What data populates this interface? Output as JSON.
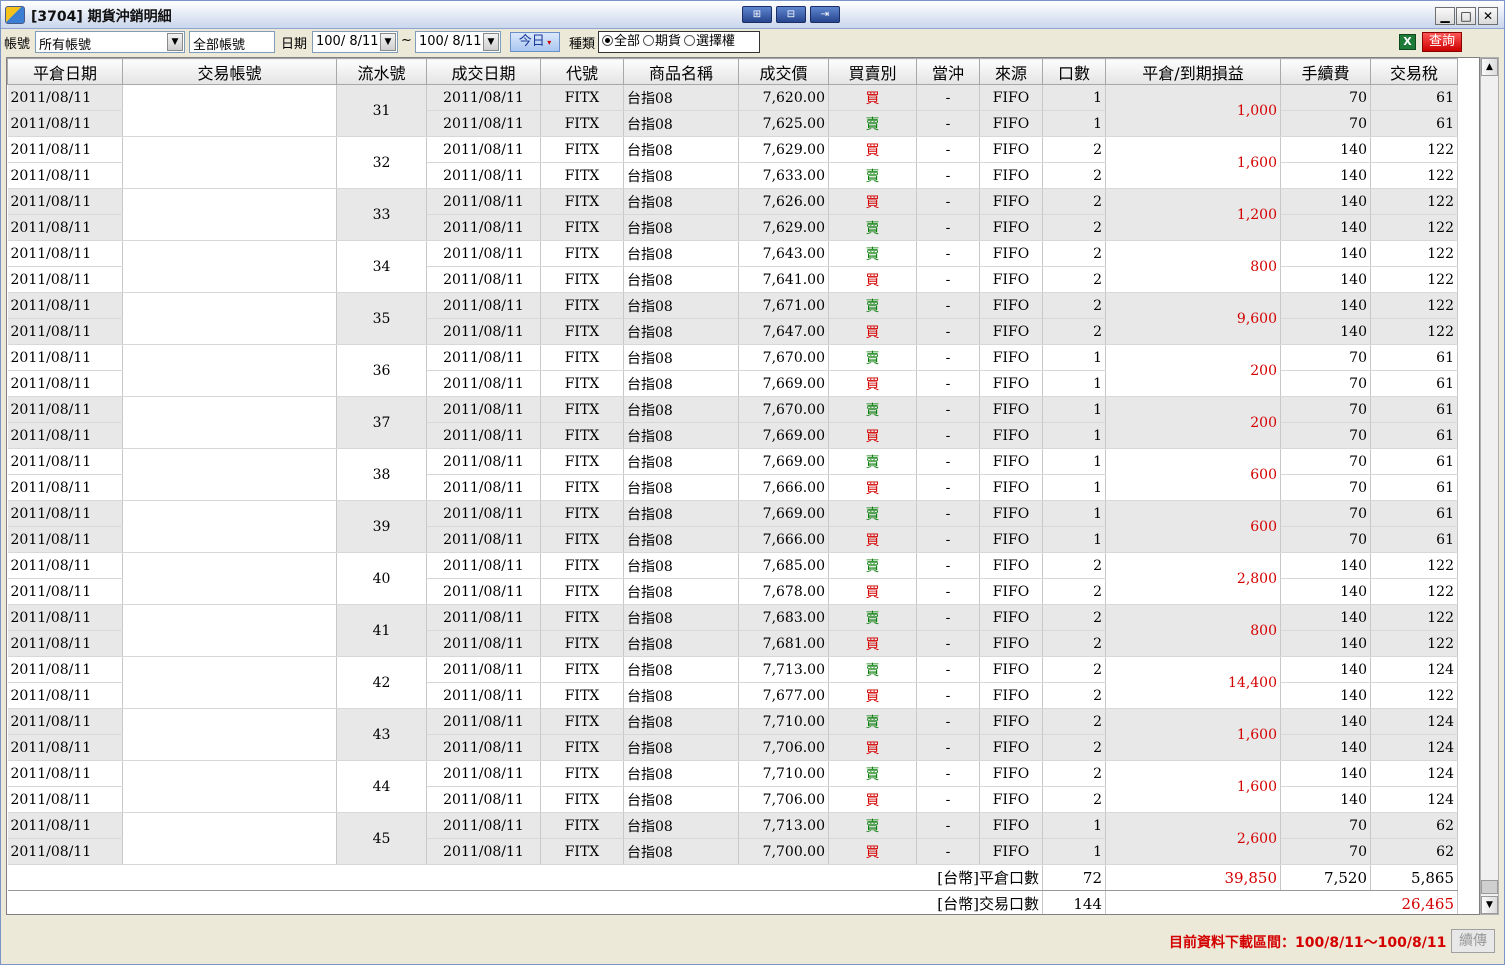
{
  "window": {
    "title": "[3704] 期貨沖銷明細",
    "mid_buttons": [
      "⊞",
      "⊟",
      "⇥"
    ],
    "controls": {
      "minimize": "▁",
      "maximize": "□",
      "close": "✕"
    }
  },
  "toolbar": {
    "account_label": "帳號",
    "account_value": "所有帳號",
    "account_type_value": "全部帳號",
    "date_label": "日期",
    "date_from": "100/ 8/11",
    "date_sep": "~",
    "date_to": "100/ 8/11",
    "today_label": "今日",
    "type_label": "種類",
    "type_options": [
      "全部",
      "期貨",
      "選擇權"
    ],
    "type_selected": "全部",
    "excel_icon": "X",
    "query_label": "查詢"
  },
  "grid": {
    "headers": [
      "平倉日期",
      "交易帳號",
      "流水號",
      "成交日期",
      "代號",
      "商品名稱",
      "成交價",
      "買賣別",
      "當沖",
      "來源",
      "口數",
      "平倉/到期損益",
      "手續費",
      "交易稅"
    ],
    "groups": [
      {
        "seq": "31",
        "pnl": "1,000",
        "rows": [
          {
            "close_date": "2011/08/11",
            "trade_date": "2011/08/11",
            "code": "FITX",
            "name": "台指08",
            "price": "7,620.00",
            "side": "買",
            "daytrade": "-",
            "source": "FIFO",
            "qty": "1",
            "fee": "70",
            "tax": "61"
          },
          {
            "close_date": "2011/08/11",
            "trade_date": "2011/08/11",
            "code": "FITX",
            "name": "台指08",
            "price": "7,625.00",
            "side": "賣",
            "daytrade": "-",
            "source": "FIFO",
            "qty": "1",
            "fee": "70",
            "tax": "61"
          }
        ]
      },
      {
        "seq": "32",
        "pnl": "1,600",
        "rows": [
          {
            "close_date": "2011/08/11",
            "trade_date": "2011/08/11",
            "code": "FITX",
            "name": "台指08",
            "price": "7,629.00",
            "side": "買",
            "daytrade": "-",
            "source": "FIFO",
            "qty": "2",
            "fee": "140",
            "tax": "122"
          },
          {
            "close_date": "2011/08/11",
            "trade_date": "2011/08/11",
            "code": "FITX",
            "name": "台指08",
            "price": "7,633.00",
            "side": "賣",
            "daytrade": "-",
            "source": "FIFO",
            "qty": "2",
            "fee": "140",
            "tax": "122"
          }
        ]
      },
      {
        "seq": "33",
        "pnl": "1,200",
        "rows": [
          {
            "close_date": "2011/08/11",
            "trade_date": "2011/08/11",
            "code": "FITX",
            "name": "台指08",
            "price": "7,626.00",
            "side": "買",
            "daytrade": "-",
            "source": "FIFO",
            "qty": "2",
            "fee": "140",
            "tax": "122"
          },
          {
            "close_date": "2011/08/11",
            "trade_date": "2011/08/11",
            "code": "FITX",
            "name": "台指08",
            "price": "7,629.00",
            "side": "賣",
            "daytrade": "-",
            "source": "FIFO",
            "qty": "2",
            "fee": "140",
            "tax": "122"
          }
        ]
      },
      {
        "seq": "34",
        "pnl": "800",
        "rows": [
          {
            "close_date": "2011/08/11",
            "trade_date": "2011/08/11",
            "code": "FITX",
            "name": "台指08",
            "price": "7,643.00",
            "side": "賣",
            "daytrade": "-",
            "source": "FIFO",
            "qty": "2",
            "fee": "140",
            "tax": "122"
          },
          {
            "close_date": "2011/08/11",
            "trade_date": "2011/08/11",
            "code": "FITX",
            "name": "台指08",
            "price": "7,641.00",
            "side": "買",
            "daytrade": "-",
            "source": "FIFO",
            "qty": "2",
            "fee": "140",
            "tax": "122"
          }
        ]
      },
      {
        "seq": "35",
        "pnl": "9,600",
        "rows": [
          {
            "close_date": "2011/08/11",
            "trade_date": "2011/08/11",
            "code": "FITX",
            "name": "台指08",
            "price": "7,671.00",
            "side": "賣",
            "daytrade": "-",
            "source": "FIFO",
            "qty": "2",
            "fee": "140",
            "tax": "122"
          },
          {
            "close_date": "2011/08/11",
            "trade_date": "2011/08/11",
            "code": "FITX",
            "name": "台指08",
            "price": "7,647.00",
            "side": "買",
            "daytrade": "-",
            "source": "FIFO",
            "qty": "2",
            "fee": "140",
            "tax": "122"
          }
        ]
      },
      {
        "seq": "36",
        "pnl": "200",
        "rows": [
          {
            "close_date": "2011/08/11",
            "trade_date": "2011/08/11",
            "code": "FITX",
            "name": "台指08",
            "price": "7,670.00",
            "side": "賣",
            "daytrade": "-",
            "source": "FIFO",
            "qty": "1",
            "fee": "70",
            "tax": "61"
          },
          {
            "close_date": "2011/08/11",
            "trade_date": "2011/08/11",
            "code": "FITX",
            "name": "台指08",
            "price": "7,669.00",
            "side": "買",
            "daytrade": "-",
            "source": "FIFO",
            "qty": "1",
            "fee": "70",
            "tax": "61"
          }
        ]
      },
      {
        "seq": "37",
        "pnl": "200",
        "rows": [
          {
            "close_date": "2011/08/11",
            "trade_date": "2011/08/11",
            "code": "FITX",
            "name": "台指08",
            "price": "7,670.00",
            "side": "賣",
            "daytrade": "-",
            "source": "FIFO",
            "qty": "1",
            "fee": "70",
            "tax": "61"
          },
          {
            "close_date": "2011/08/11",
            "trade_date": "2011/08/11",
            "code": "FITX",
            "name": "台指08",
            "price": "7,669.00",
            "side": "買",
            "daytrade": "-",
            "source": "FIFO",
            "qty": "1",
            "fee": "70",
            "tax": "61"
          }
        ]
      },
      {
        "seq": "38",
        "pnl": "600",
        "rows": [
          {
            "close_date": "2011/08/11",
            "trade_date": "2011/08/11",
            "code": "FITX",
            "name": "台指08",
            "price": "7,669.00",
            "side": "賣",
            "daytrade": "-",
            "source": "FIFO",
            "qty": "1",
            "fee": "70",
            "tax": "61"
          },
          {
            "close_date": "2011/08/11",
            "trade_date": "2011/08/11",
            "code": "FITX",
            "name": "台指08",
            "price": "7,666.00",
            "side": "買",
            "daytrade": "-",
            "source": "FIFO",
            "qty": "1",
            "fee": "70",
            "tax": "61"
          }
        ]
      },
      {
        "seq": "39",
        "pnl": "600",
        "rows": [
          {
            "close_date": "2011/08/11",
            "trade_date": "2011/08/11",
            "code": "FITX",
            "name": "台指08",
            "price": "7,669.00",
            "side": "賣",
            "daytrade": "-",
            "source": "FIFO",
            "qty": "1",
            "fee": "70",
            "tax": "61"
          },
          {
            "close_date": "2011/08/11",
            "trade_date": "2011/08/11",
            "code": "FITX",
            "name": "台指08",
            "price": "7,666.00",
            "side": "買",
            "daytrade": "-",
            "source": "FIFO",
            "qty": "1",
            "fee": "70",
            "tax": "61"
          }
        ]
      },
      {
        "seq": "40",
        "pnl": "2,800",
        "rows": [
          {
            "close_date": "2011/08/11",
            "trade_date": "2011/08/11",
            "code": "FITX",
            "name": "台指08",
            "price": "7,685.00",
            "side": "賣",
            "daytrade": "-",
            "source": "FIFO",
            "qty": "2",
            "fee": "140",
            "tax": "122"
          },
          {
            "close_date": "2011/08/11",
            "trade_date": "2011/08/11",
            "code": "FITX",
            "name": "台指08",
            "price": "7,678.00",
            "side": "買",
            "daytrade": "-",
            "source": "FIFO",
            "qty": "2",
            "fee": "140",
            "tax": "122"
          }
        ]
      },
      {
        "seq": "41",
        "pnl": "800",
        "rows": [
          {
            "close_date": "2011/08/11",
            "trade_date": "2011/08/11",
            "code": "FITX",
            "name": "台指08",
            "price": "7,683.00",
            "side": "賣",
            "daytrade": "-",
            "source": "FIFO",
            "qty": "2",
            "fee": "140",
            "tax": "122"
          },
          {
            "close_date": "2011/08/11",
            "trade_date": "2011/08/11",
            "code": "FITX",
            "name": "台指08",
            "price": "7,681.00",
            "side": "買",
            "daytrade": "-",
            "source": "FIFO",
            "qty": "2",
            "fee": "140",
            "tax": "122"
          }
        ]
      },
      {
        "seq": "42",
        "pnl": "14,400",
        "rows": [
          {
            "close_date": "2011/08/11",
            "trade_date": "2011/08/11",
            "code": "FITX",
            "name": "台指08",
            "price": "7,713.00",
            "side": "賣",
            "daytrade": "-",
            "source": "FIFO",
            "qty": "2",
            "fee": "140",
            "tax": "124"
          },
          {
            "close_date": "2011/08/11",
            "trade_date": "2011/08/11",
            "code": "FITX",
            "name": "台指08",
            "price": "7,677.00",
            "side": "買",
            "daytrade": "-",
            "source": "FIFO",
            "qty": "2",
            "fee": "140",
            "tax": "122"
          }
        ]
      },
      {
        "seq": "43",
        "pnl": "1,600",
        "rows": [
          {
            "close_date": "2011/08/11",
            "trade_date": "2011/08/11",
            "code": "FITX",
            "name": "台指08",
            "price": "7,710.00",
            "side": "賣",
            "daytrade": "-",
            "source": "FIFO",
            "qty": "2",
            "fee": "140",
            "tax": "124"
          },
          {
            "close_date": "2011/08/11",
            "trade_date": "2011/08/11",
            "code": "FITX",
            "name": "台指08",
            "price": "7,706.00",
            "side": "買",
            "daytrade": "-",
            "source": "FIFO",
            "qty": "2",
            "fee": "140",
            "tax": "124"
          }
        ]
      },
      {
        "seq": "44",
        "pnl": "1,600",
        "rows": [
          {
            "close_date": "2011/08/11",
            "trade_date": "2011/08/11",
            "code": "FITX",
            "name": "台指08",
            "price": "7,710.00",
            "side": "賣",
            "daytrade": "-",
            "source": "FIFO",
            "qty": "2",
            "fee": "140",
            "tax": "124"
          },
          {
            "close_date": "2011/08/11",
            "trade_date": "2011/08/11",
            "code": "FITX",
            "name": "台指08",
            "price": "7,706.00",
            "side": "買",
            "daytrade": "-",
            "source": "FIFO",
            "qty": "2",
            "fee": "140",
            "tax": "124"
          }
        ]
      },
      {
        "seq": "45",
        "pnl": "2,600",
        "rows": [
          {
            "close_date": "2011/08/11",
            "trade_date": "2011/08/11",
            "code": "FITX",
            "name": "台指08",
            "price": "7,713.00",
            "side": "賣",
            "daytrade": "-",
            "source": "FIFO",
            "qty": "1",
            "fee": "70",
            "tax": "62"
          },
          {
            "close_date": "2011/08/11",
            "trade_date": "2011/08/11",
            "code": "FITX",
            "name": "台指08",
            "price": "7,700.00",
            "side": "買",
            "daytrade": "-",
            "source": "FIFO",
            "qty": "1",
            "fee": "70",
            "tax": "62"
          }
        ]
      }
    ],
    "summary": [
      {
        "label": "[台幣]平倉口數",
        "qty": "72",
        "pnl": "39,850",
        "fee": "7,520",
        "tax": "5,865"
      },
      {
        "label": "[台幣]交易口數",
        "qty": "144",
        "total": "26,465"
      }
    ]
  },
  "scrollbar": {
    "up": "▲",
    "down": "▼"
  },
  "status": {
    "text": "目前資料下載區間：100/8/11～100/8/11",
    "continue_label": "續傳"
  },
  "colors": {
    "buy": "#d40000",
    "sell": "#007a00",
    "pnl": "#d40000",
    "alt_row": "#e8e8e8"
  }
}
